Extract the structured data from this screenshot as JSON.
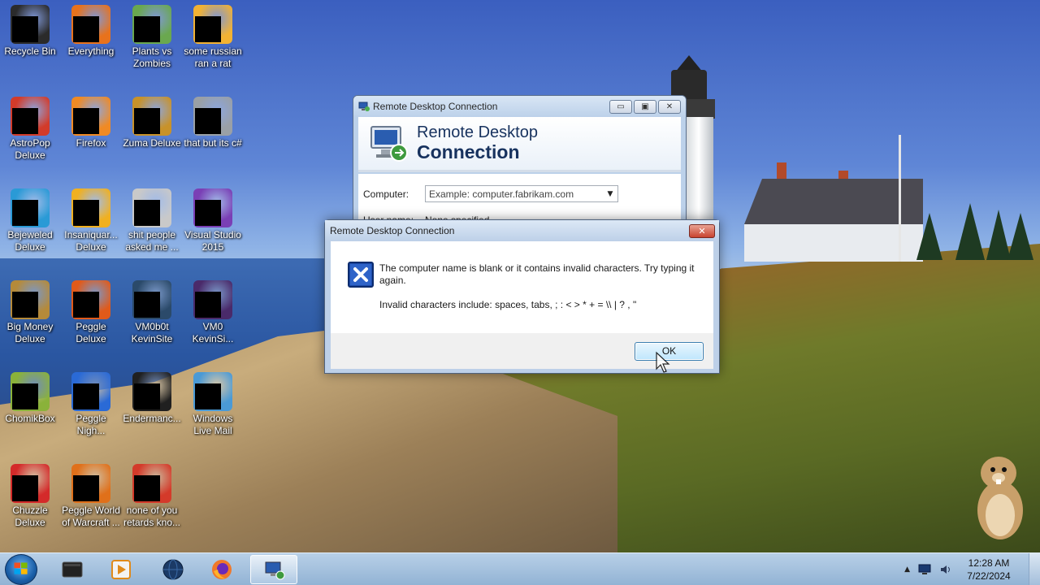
{
  "desktop_icons": [
    {
      "label": "Recycle Bin",
      "icon": "recycle-bin-icon",
      "color": "#2b2b2b"
    },
    {
      "label": "Everything",
      "icon": "everything-icon",
      "color": "#e8721c"
    },
    {
      "label": "Plants vs Zombies",
      "icon": "plants-vs-zombies-icon",
      "color": "#6aa84f"
    },
    {
      "label": "some russian ran a rat",
      "icon": "application-icon",
      "color": "#f2b233"
    },
    {
      "label": "AstroPop Deluxe",
      "icon": "astropop-icon",
      "color": "#d23b2a"
    },
    {
      "label": "Firefox",
      "icon": "firefox-icon",
      "color": "#f08a24"
    },
    {
      "label": "Zuma Deluxe",
      "icon": "zuma-icon",
      "color": "#c8922a"
    },
    {
      "label": "that but its c#",
      "icon": "copy-files-icon",
      "color": "#9aa0a6"
    },
    {
      "label": "Bejeweled Deluxe",
      "icon": "bejeweled-icon",
      "color": "#2a9ad6"
    },
    {
      "label": "Insaniquar... Deluxe",
      "icon": "insaniquarium-icon",
      "color": "#f0b020"
    },
    {
      "label": "shit people asked me ...",
      "icon": "folder-icon",
      "color": "#c9c9c9"
    },
    {
      "label": "Visual Studio 2015",
      "icon": "visual-studio-icon",
      "color": "#7a3fb5"
    },
    {
      "label": "Big Money Deluxe",
      "icon": "money-bag-icon",
      "color": "#b58a3a"
    },
    {
      "label": "Peggle Deluxe",
      "icon": "peggle-icon",
      "color": "#e05a1a"
    },
    {
      "label": "VM0b0t KevinSite",
      "icon": "vm-shortcut-icon",
      "color": "#2b4a6a"
    },
    {
      "label": "VM0 KevinSi...",
      "icon": "vm-shortcut-icon",
      "color": "#4a2a6a"
    },
    {
      "label": "ChomikBox",
      "icon": "chomikbox-icon",
      "color": "#8ab23a"
    },
    {
      "label": "Peggle Nigh...",
      "icon": "peggle-nights-icon",
      "color": "#2a6ad6"
    },
    {
      "label": "Endermanc...",
      "icon": "terminal-icon",
      "color": "#202020"
    },
    {
      "label": "Windows Live Mail",
      "icon": "windows-live-mail-icon",
      "color": "#4a9ad6"
    },
    {
      "label": "Chuzzle Deluxe",
      "icon": "chuzzle-icon",
      "color": "#d42a2a"
    },
    {
      "label": "Peggle World of Warcraft ...",
      "icon": "peggle-wow-icon",
      "color": "#e0701a"
    },
    {
      "label": "none of you retards kno...",
      "icon": "opera-like-icon",
      "color": "#d43a2a"
    }
  ],
  "rdc_window": {
    "title": "Remote Desktop Connection",
    "brand_line1": "Remote Desktop",
    "brand_line2": "Connection",
    "computer_label": "Computer:",
    "computer_placeholder": "Example: computer.fabrikam.com",
    "username_label": "User name:",
    "username_value": "None specified",
    "minimize_symbol": "▭",
    "maximize_symbol": "▣",
    "close_symbol": "✕"
  },
  "error_dialog": {
    "title": "Remote Desktop Connection",
    "message_line1": "The computer name is blank or it contains invalid characters. Try typing it again.",
    "message_line2": "Invalid characters include: spaces, tabs, ; : < > * + = \\\\ | ? , \"",
    "ok_label": "OK",
    "close_symbol": "✕"
  },
  "taskbar": {
    "items": [
      {
        "icon": "start-orb-icon",
        "name": "start"
      },
      {
        "icon": "terminal-icon",
        "name": "app-1"
      },
      {
        "icon": "media-player-icon",
        "name": "app-2"
      },
      {
        "icon": "globe-icon",
        "name": "app-3"
      },
      {
        "icon": "firefox-icon",
        "name": "firefox"
      },
      {
        "icon": "remote-desktop-icon",
        "name": "remote-desktop"
      }
    ],
    "clock_time": "12:28 AM",
    "clock_date": "7/22/2024"
  }
}
